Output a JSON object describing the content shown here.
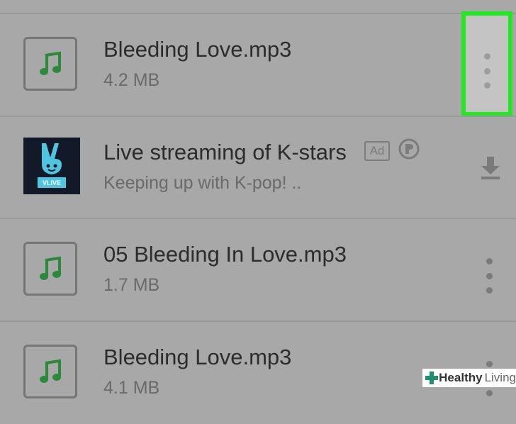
{
  "list": {
    "items": [
      {
        "type": "file",
        "title": "Bleeding Love.mp3",
        "subtitle": "4.2 MB",
        "icon": "music-note-icon",
        "menu_highlighted": true
      },
      {
        "type": "ad",
        "title": "Live streaming of K-stars",
        "subtitle": "Keeping up with K-pop! ..",
        "badge": "Ad",
        "thumb_text": "VLIVE",
        "icon": "vlive-logo",
        "action_icon": "download-icon"
      },
      {
        "type": "file",
        "title": "05 Bleeding In Love.mp3",
        "subtitle": "1.7 MB",
        "icon": "music-note-icon"
      },
      {
        "type": "file",
        "title": "Bleeding Love.mp3",
        "subtitle": "4.1 MB",
        "icon": "music-note-icon"
      }
    ]
  },
  "watermark": {
    "bold": "Healthy",
    "light": "Living"
  },
  "colors": {
    "background": "#a8a8a8",
    "highlight": "#22e822",
    "note": "#2a8a3a",
    "vlive_bg": "#121a2a",
    "vlive_accent": "#4ec6e0"
  }
}
